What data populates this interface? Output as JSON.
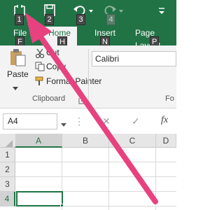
{
  "qat": {
    "keytips": [
      "1",
      "2",
      "3",
      "4"
    ],
    "icons": [
      "touch-mode-icon",
      "save-icon",
      "undo-icon",
      "redo-icon"
    ]
  },
  "tabs": [
    {
      "label": "File",
      "keytip": "F"
    },
    {
      "label": "Home",
      "keytip": "H",
      "active": true
    },
    {
      "label": "Insert",
      "keytip": "N"
    },
    {
      "label": "Page Layout",
      "keytip": "P"
    }
  ],
  "ribbon": {
    "paste_label": "Paste",
    "cut_label": "Cut",
    "copy_label": "Copy",
    "format_painter_label": "Format Painter",
    "clipboard_group_label": "Clipboard",
    "font_name": "Calibri",
    "font_group_label": "Fo"
  },
  "formula_bar": {
    "name_box_value": "A4",
    "fx_label": "fx"
  },
  "grid": {
    "columns": [
      "A",
      "B",
      "C",
      "D"
    ],
    "rows": [
      "1",
      "2",
      "3",
      "4"
    ],
    "active_cell": "A4"
  },
  "colors": {
    "excel_green": "#217346",
    "arrow_pink": "#e8417f"
  }
}
